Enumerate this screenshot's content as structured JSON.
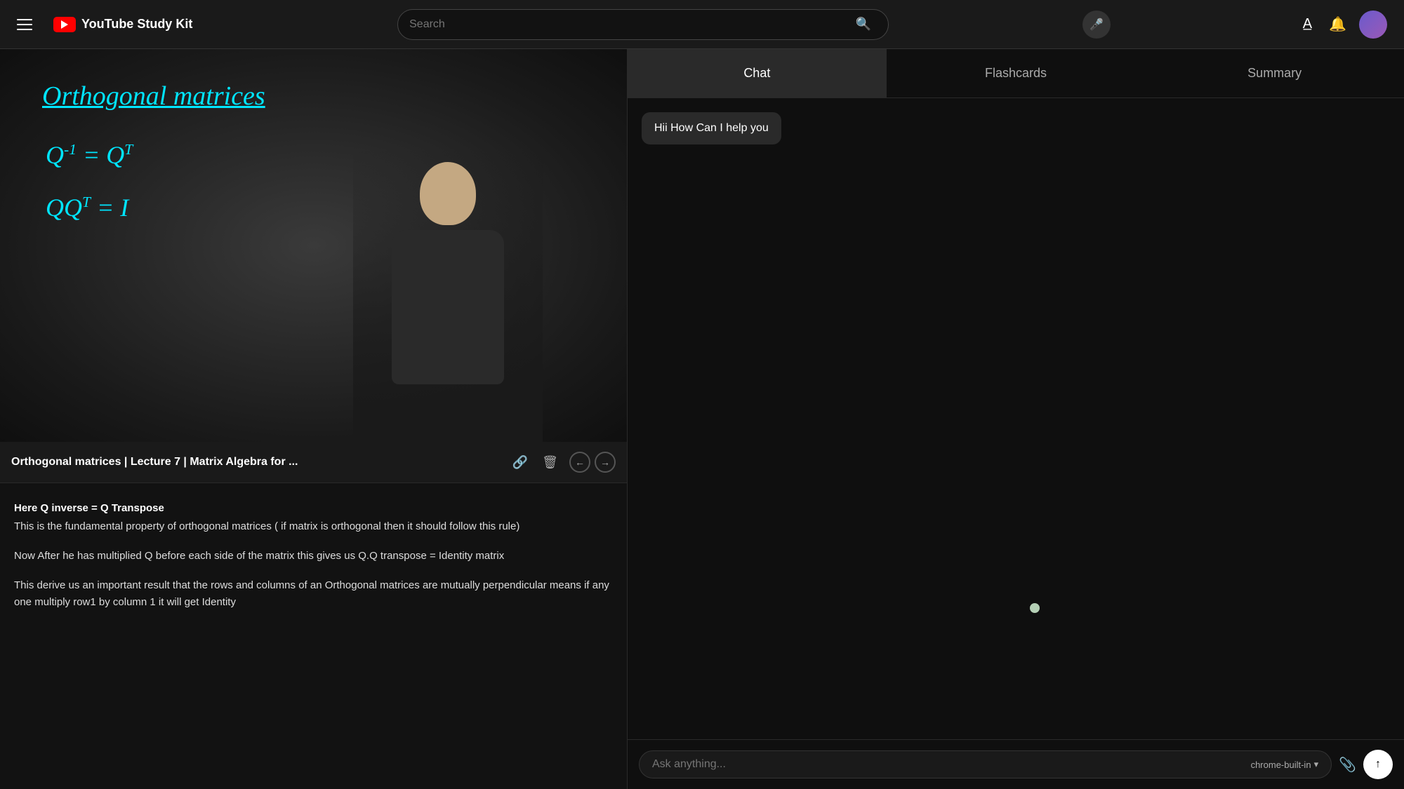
{
  "app": {
    "name": "YouTube Study Kit"
  },
  "nav": {
    "search_placeholder": "Search",
    "translate_label": "Translate",
    "bell_label": "Notifications",
    "avatar_label": "User Avatar"
  },
  "video": {
    "title": "Orthogonal matrices | Lecture 7 | Matrix Algebra for ...",
    "math_title": "Orthogonal matrices",
    "math_eq1": "Q⁻¹ = Qᵀ",
    "math_eq2": "QQᵀ = I"
  },
  "notes": {
    "line1": "Here Q inverse = Q Transpose",
    "line2": "This is the fundamental property of orthogonal matrices ( if matrix is orthogonal then it should follow this rule)",
    "line3": "Now After he has multiplied Q before each side of the matrix this gives us Q.Q transpose = Identity matrix",
    "line4": "This derive us an important result that the rows and columns of an Orthogonal matrices are mutually perpendicular means if any one multiply row1 by column 1 it will get Identity"
  },
  "tabs": {
    "chat_label": "Chat",
    "flashcards_label": "Flashcards",
    "summary_label": "Summary"
  },
  "chat": {
    "greeting": "Hii How Can I help you",
    "input_placeholder": "Ask anything...",
    "model_label": "chrome-built-in",
    "model_dropdown": "▾"
  },
  "icons": {
    "hamburger": "≡",
    "search": "🔍",
    "mic": "🎤",
    "translate": "A",
    "bell": "🔔",
    "link": "🔗",
    "trash": "🗑",
    "prev_arrow": "←",
    "next_arrow": "→",
    "attach": "📎",
    "send": "↑"
  }
}
